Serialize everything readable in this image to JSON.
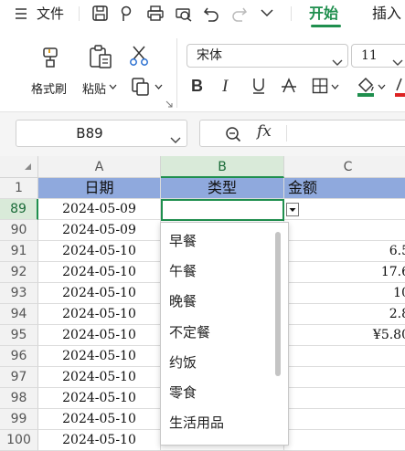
{
  "menu": {
    "file_label": "文件",
    "tabs": [
      {
        "label": "开始",
        "active": true
      },
      {
        "label": "插入",
        "active": false
      }
    ]
  },
  "ribbon": {
    "format_painter_label": "格式刷",
    "paste_label": "粘贴",
    "font_name": "宋体",
    "font_size": "11"
  },
  "formula_bar": {
    "cell_ref": "B89",
    "fx_symbol": "fx"
  },
  "colors": {
    "accent": "#1f8f4e",
    "header_fill": "#8fa9dd"
  },
  "sheet": {
    "columns": [
      "A",
      "B",
      "C"
    ],
    "rows": [
      {
        "num": "1",
        "a": "日期",
        "b": "类型",
        "c": "金额"
      },
      {
        "num": "89",
        "a": "2024-05-09",
        "b": "",
        "c": ""
      },
      {
        "num": "90",
        "a": "2024-05-09",
        "b": "",
        "c": ""
      },
      {
        "num": "91",
        "a": "2024-05-10",
        "b": "",
        "c": "6.5"
      },
      {
        "num": "92",
        "a": "2024-05-10",
        "b": "",
        "c": "17.6"
      },
      {
        "num": "93",
        "a": "2024-05-10",
        "b": "",
        "c": "10"
      },
      {
        "num": "94",
        "a": "2024-05-10",
        "b": "",
        "c": "2.8"
      },
      {
        "num": "95",
        "a": "2024-05-10",
        "b": "",
        "c": "¥5.80"
      },
      {
        "num": "96",
        "a": "2024-05-10",
        "b": "",
        "c": ""
      },
      {
        "num": "97",
        "a": "2024-05-10",
        "b": "",
        "c": ""
      },
      {
        "num": "98",
        "a": "2024-05-10",
        "b": "",
        "c": ""
      },
      {
        "num": "99",
        "a": "2024-05-10",
        "b": "",
        "c": ""
      },
      {
        "num": "100",
        "a": "2024-05-10",
        "b": "",
        "c": ""
      }
    ]
  },
  "dropdown": {
    "options": [
      "早餐",
      "午餐",
      "晚餐",
      "不定餐",
      "约饭",
      "零食",
      "生活用品"
    ]
  }
}
